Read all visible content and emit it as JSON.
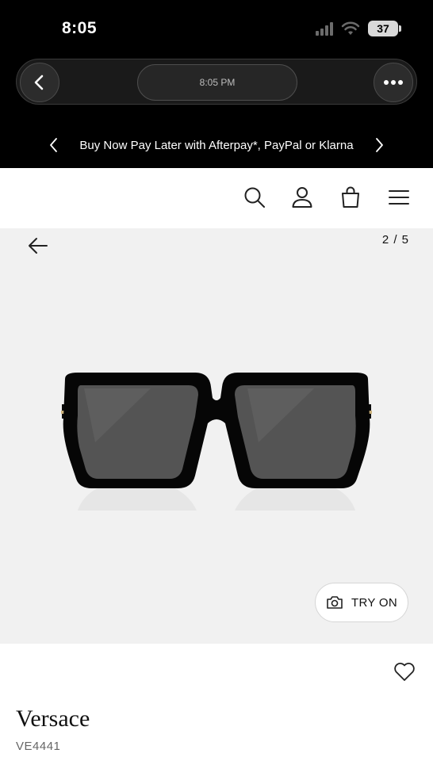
{
  "status": {
    "time": "8:05",
    "battery": "37"
  },
  "browser": {
    "url_time": "8:05 PM"
  },
  "promo": {
    "text": "Buy Now Pay Later with Afterpay*, PayPal or Klarna"
  },
  "gallery": {
    "counter": "2 / 5",
    "try_on_label": "TRY ON"
  },
  "product": {
    "brand": "Versace",
    "model": "VE4441"
  },
  "colors": {
    "top_bar": "#000000",
    "gallery_bg": "#f1f1f1",
    "text": "#111111",
    "muted": "#666666"
  },
  "icons": [
    "back-icon",
    "more-icon",
    "search-icon",
    "account-icon",
    "bag-icon",
    "menu-icon",
    "arrow-left-icon",
    "camera-icon",
    "heart-icon"
  ]
}
